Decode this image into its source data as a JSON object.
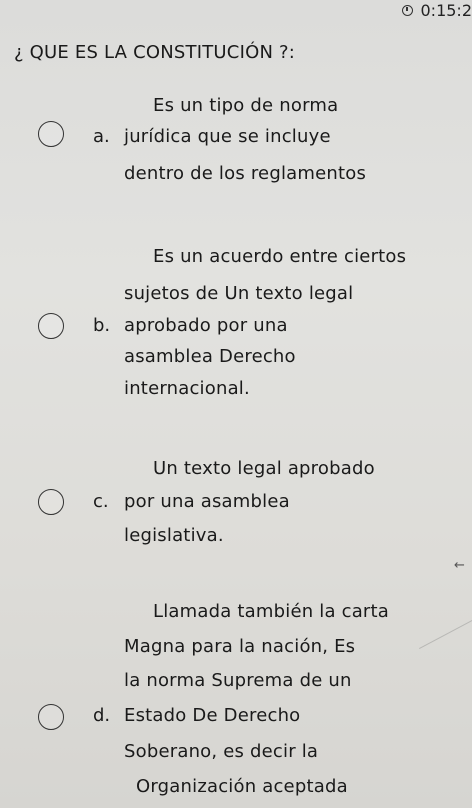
{
  "timer": {
    "icon": "stopwatch-icon",
    "time": "0:15:2"
  },
  "question": {
    "text": "¿ QUE ES LA CONSTITUCIÓN ?:"
  },
  "options": [
    {
      "letter": "a.",
      "lines": [
        "Es un tipo de norma",
        "jurídica que se incluye",
        "dentro de los reglamentos"
      ]
    },
    {
      "letter": "b.",
      "lines": [
        "Es un acuerdo entre ciertos",
        "sujetos de Un texto legal",
        "aprobado por una",
        "asamblea Derecho",
        "internacional."
      ]
    },
    {
      "letter": "c.",
      "lines": [
        "Un texto legal aprobado",
        "por una asamblea",
        "legislativa."
      ]
    },
    {
      "letter": "d.",
      "lines": [
        "Llamada también la carta",
        "Magna para la nación, Es",
        "la norma Suprema de un",
        "Estado De Derecho",
        "Soberano, es decir la",
        "Organización aceptada"
      ]
    }
  ],
  "misc": {
    "arrow_glyph": "←"
  }
}
